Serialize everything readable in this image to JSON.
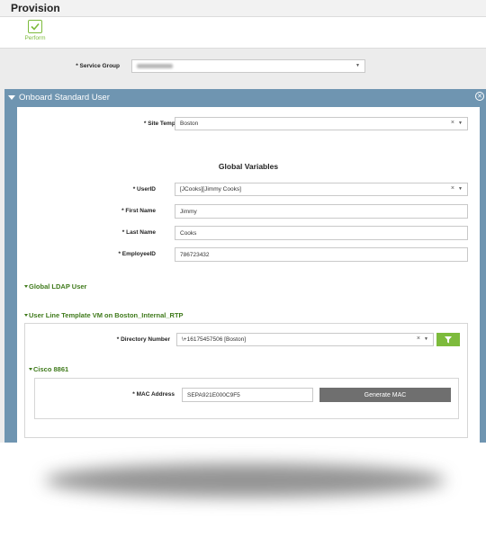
{
  "page": {
    "title": "Provision"
  },
  "toolbar": {
    "perform_label": "Perform"
  },
  "service_group": {
    "label": "* Service Group"
  },
  "panel": {
    "title": "Onboard Standard User",
    "site_template": {
      "label": "* Site Template",
      "value": "Boston"
    },
    "global_variables_title": "Global Variables",
    "user_id": {
      "label": "* UserID",
      "value": "[JCooks][Jimmy Cooks]"
    },
    "first_name": {
      "label": "* First Name",
      "value": "Jimmy"
    },
    "last_name": {
      "label": "* Last Name",
      "value": "Cooks"
    },
    "employee_id": {
      "label": "* EmployeeID",
      "value": "786723432"
    },
    "global_ldap_user": "Global LDAP User",
    "user_line_template": "User Line Template VM on Boston_Internal_RTP",
    "directory_number": {
      "label": "* Directory Number",
      "value": "\\+16175457506 [Boston]"
    },
    "cisco_section": "Cisco 8861",
    "mac_address": {
      "label": "* MAC Address",
      "value": "SEPA921E000C9F5"
    },
    "generate_mac_label": "Generate MAC"
  },
  "colors": {
    "accent_green": "#7dbb3c",
    "section_green": "#3f7a1b",
    "panel_blue": "#6f95b1",
    "button_gray": "#6f6f6f"
  },
  "icons": {
    "perform": "checkmark-icon",
    "close": "close-circle-icon",
    "filter": "filter-icon"
  }
}
